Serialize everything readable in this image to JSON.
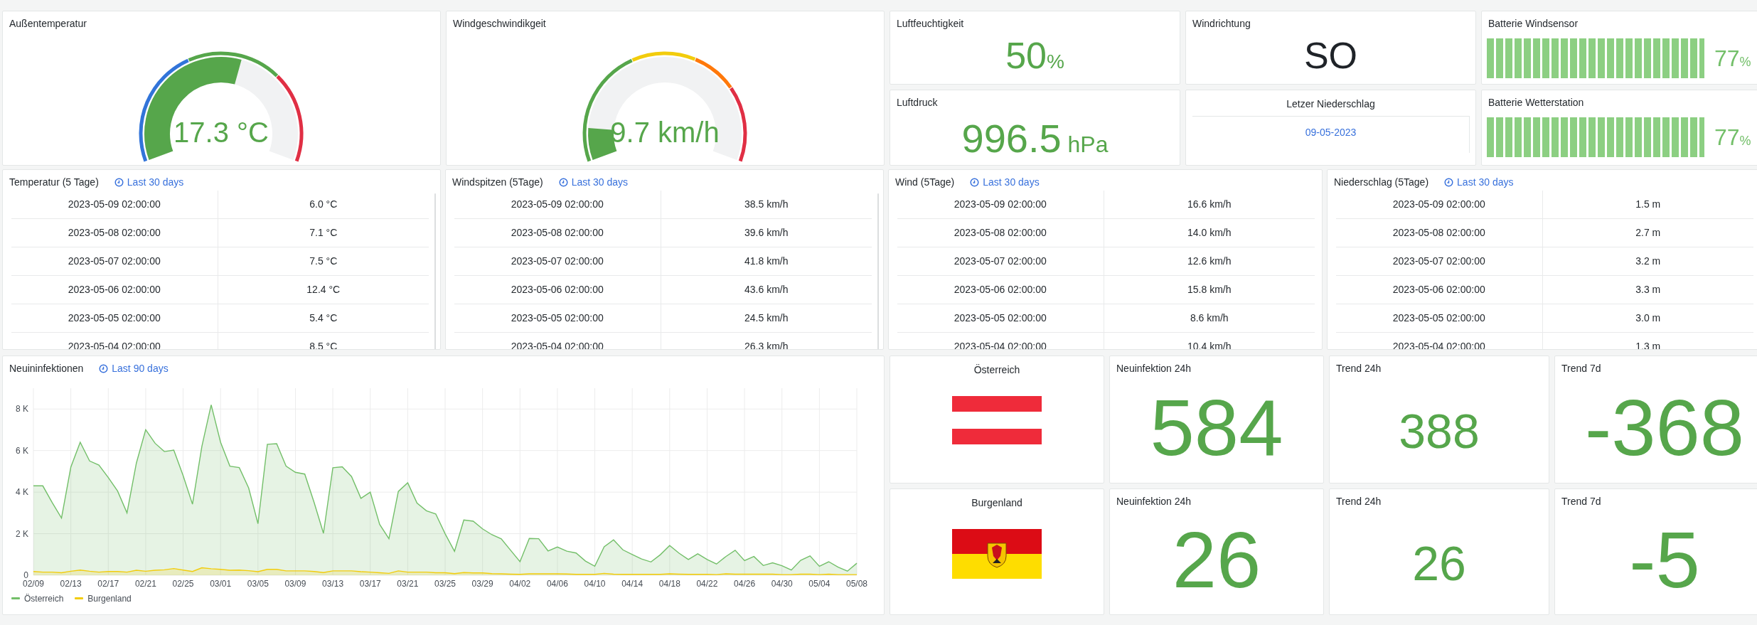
{
  "gauges": [
    {
      "title": "Außentemperatur",
      "value": "17.3 °C",
      "bands": [
        {
          "color": "#3274d9"
        },
        {
          "color": "#56a64b"
        },
        {
          "color": "#e02f44"
        }
      ]
    },
    {
      "title": "Windgeschwindikgeit",
      "value": "9.7 km/h",
      "bands": [
        {
          "color": "#56a64b"
        },
        {
          "color": "#f2cc0c"
        },
        {
          "color": "#ff780a"
        },
        {
          "color": "#e02f44"
        }
      ]
    }
  ],
  "stats": [
    {
      "title": "Luftfeuchtigkeit",
      "value": "50",
      "unit": "%",
      "kind": "number"
    },
    {
      "title": "Luftdruck",
      "value": "996.5",
      "unit": "hPa",
      "kind": "number"
    },
    {
      "title": "Windrichtung",
      "value": "SO",
      "kind": "text"
    }
  ],
  "last_rain": {
    "title": "Letzer Niederschlag",
    "value": "09-05-2023"
  },
  "batteries": [
    {
      "title": "Batterie Windsensor",
      "level": 1,
      "reading": "77",
      "unit": "%"
    },
    {
      "title": "Batterie Wetterstation",
      "level": 1,
      "reading": "77",
      "unit": "%"
    }
  ],
  "tables": [
    {
      "title": "Temperatur (5 Tage)",
      "time_range": "Last 30 days",
      "rows": [
        [
          "2023-05-09 02:00:00",
          "6.0 °C"
        ],
        [
          "2023-05-08 02:00:00",
          "7.1 °C"
        ],
        [
          "2023-05-07 02:00:00",
          "7.5 °C"
        ],
        [
          "2023-05-06 02:00:00",
          "12.4 °C"
        ],
        [
          "2023-05-05 02:00:00",
          "5.4 °C"
        ],
        [
          "2023-05-04 02:00:00",
          "8.5 °C"
        ]
      ]
    },
    {
      "title": "Windspitzen (5Tage)",
      "time_range": "Last 30 days",
      "rows": [
        [
          "2023-05-09 02:00:00",
          "38.5 km/h"
        ],
        [
          "2023-05-08 02:00:00",
          "39.6 km/h"
        ],
        [
          "2023-05-07 02:00:00",
          "41.8 km/h"
        ],
        [
          "2023-05-06 02:00:00",
          "43.6 km/h"
        ],
        [
          "2023-05-05 02:00:00",
          "24.5 km/h"
        ],
        [
          "2023-05-04 02:00:00",
          "26.3 km/h"
        ]
      ]
    },
    {
      "title": "Wind (5Tage)",
      "time_range": "Last 30 days",
      "rows": [
        [
          "2023-05-09 02:00:00",
          "16.6 km/h"
        ],
        [
          "2023-05-08 02:00:00",
          "14.0 km/h"
        ],
        [
          "2023-05-07 02:00:00",
          "12.6 km/h"
        ],
        [
          "2023-05-06 02:00:00",
          "15.8 km/h"
        ],
        [
          "2023-05-05 02:00:00",
          "8.6 km/h"
        ],
        [
          "2023-05-04 02:00:00",
          "10.4 km/h"
        ]
      ]
    },
    {
      "title": "Niederschlag (5Tage)",
      "time_range": "Last 30 days",
      "rows": [
        [
          "2023-05-09 02:00:00",
          "1.5 m"
        ],
        [
          "2023-05-08 02:00:00",
          "2.7 m"
        ],
        [
          "2023-05-07 02:00:00",
          "3.2 m"
        ],
        [
          "2023-05-06 02:00:00",
          "3.3 m"
        ],
        [
          "2023-05-05 02:00:00",
          "3.0 m"
        ],
        [
          "2023-05-04 02:00:00",
          "1.3 m"
        ]
      ]
    }
  ],
  "chart": {
    "title": "Neuininfektionen",
    "time_range": "Last 90 days",
    "chart_data": {
      "type": "area",
      "grid": true,
      "categories": [
        "02/09",
        null,
        null,
        null,
        "02/13",
        null,
        null,
        null,
        "02/17",
        null,
        null,
        null,
        "02/21",
        null,
        null,
        null,
        "02/25",
        null,
        null,
        null,
        "03/01",
        null,
        null,
        null,
        "03/05",
        null,
        null,
        null,
        "03/09",
        null,
        null,
        null,
        "03/13",
        null,
        null,
        null,
        "03/17",
        null,
        null,
        null,
        "03/21",
        null,
        null,
        null,
        "03/25",
        null,
        null,
        null,
        "03/29",
        null,
        null,
        null,
        "04/02",
        null,
        null,
        null,
        "04/06",
        null,
        null,
        null,
        "04/10",
        null,
        null,
        null,
        "04/14",
        null,
        null,
        null,
        "04/18",
        null,
        null,
        null,
        "04/22",
        null,
        null,
        null,
        "04/26",
        null,
        null,
        null,
        "04/30",
        null,
        null,
        null,
        "05/04",
        null,
        null,
        null,
        "05/08"
      ],
      "series": [
        {
          "name": "Österreich",
          "color": "#73bf69",
          "values": [
            4300,
            4300,
            3500,
            2750,
            5200,
            6400,
            5500,
            5300,
            4700,
            4050,
            3000,
            5400,
            7000,
            6350,
            5950,
            6020,
            4800,
            3420,
            6200,
            8200,
            6400,
            5250,
            5180,
            4200,
            2480,
            6300,
            6330,
            5250,
            4950,
            4870,
            3500,
            2020,
            5170,
            5220,
            4750,
            3700,
            4000,
            2450,
            1760,
            4030,
            4450,
            3470,
            3100,
            2950,
            2000,
            1150,
            2660,
            2600,
            2230,
            1950,
            1750,
            1200,
            650,
            1770,
            1760,
            1170,
            1360,
            1160,
            1070,
            680,
            430,
            1370,
            1700,
            1220,
            1000,
            780,
            640,
            990,
            1430,
            1060,
            760,
            1030,
            760,
            540,
            900,
            1200,
            700,
            900,
            470,
            600,
            460,
            250,
            720,
            930,
            430,
            650,
            390,
            200,
            580
          ]
        },
        {
          "name": "Burgenland",
          "color": "#f2cc0c",
          "values": [
            180,
            150,
            150,
            120,
            190,
            250,
            190,
            150,
            180,
            180,
            150,
            240,
            190,
            240,
            260,
            320,
            250,
            180,
            360,
            310,
            280,
            240,
            250,
            220,
            170,
            280,
            280,
            210,
            210,
            210,
            180,
            130,
            210,
            210,
            210,
            170,
            150,
            120,
            90,
            210,
            150,
            150,
            150,
            120,
            120,
            80,
            130,
            110,
            110,
            80,
            70,
            50,
            40,
            70,
            70,
            70,
            70,
            60,
            40,
            40,
            40,
            90,
            50,
            40,
            40,
            40,
            40,
            40,
            70,
            50,
            40,
            40,
            40,
            30,
            70,
            50,
            50,
            50,
            50,
            50,
            30,
            30,
            50,
            50,
            30,
            50,
            30,
            30,
            30
          ]
        }
      ],
      "ylim": [
        0,
        9000
      ],
      "yticks": [
        {
          "value": 0,
          "label": "0"
        },
        {
          "value": 2000,
          "label": "2 K"
        },
        {
          "value": 4000,
          "label": "4 K"
        },
        {
          "value": 6000,
          "label": "6 K"
        },
        {
          "value": 8000,
          "label": "8 K"
        }
      ]
    }
  },
  "regions": [
    {
      "name": "Österreich",
      "kind": "austria",
      "tiles": [
        {
          "title": "Neuinfektion 24h",
          "value": "584",
          "kind": "large"
        },
        {
          "title": "Trend 24h",
          "value": "388",
          "kind": "medium"
        },
        {
          "title": "Trend 7d",
          "value": "-368",
          "kind": "large"
        }
      ]
    },
    {
      "name": "Burgenland",
      "kind": "burgenland",
      "tiles": [
        {
          "title": "Neuinfektion 24h",
          "value": "26",
          "kind": "large"
        },
        {
          "title": "Trend 24h",
          "value": "26",
          "kind": "medium"
        },
        {
          "title": "Trend 7d",
          "value": "-5",
          "kind": "large"
        }
      ]
    }
  ]
}
